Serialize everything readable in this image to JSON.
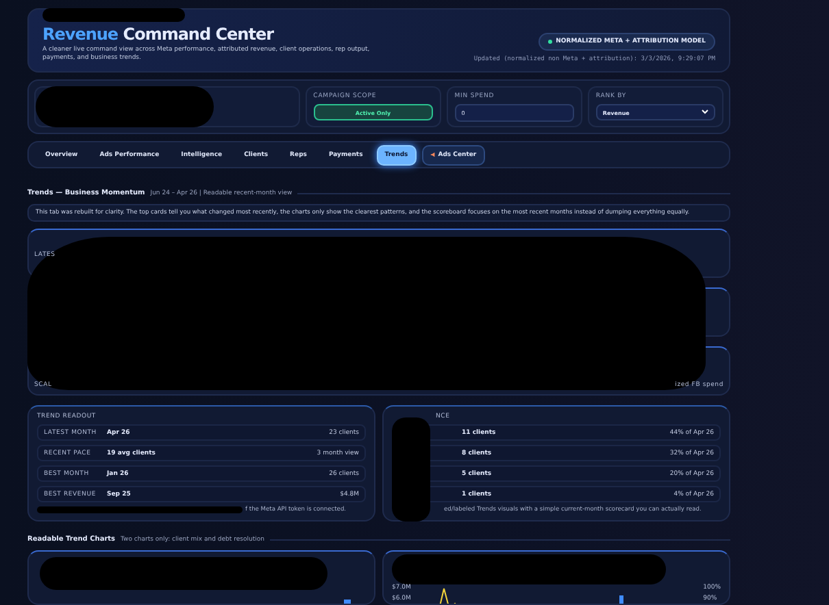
{
  "header": {
    "title_accent": "Revenue",
    "title": "Command Center",
    "subtitle": "A cleaner live command view across Meta performance, attributed revenue, client operations, rep output, payments, and business trends.",
    "badge": "NORMALIZED META + ATTRIBUTION MODEL",
    "updated": "Updated (normalized non Meta + attribution): 3/3/2026, 9:29:07 PM"
  },
  "filters": [
    {
      "kind": "toggle",
      "label": "CAMPAIGN SCOPE",
      "value": "Active Only"
    },
    {
      "kind": "input",
      "label": "MIN SPEND",
      "value": "0"
    },
    {
      "kind": "select",
      "label": "RANK BY",
      "value": "Revenue"
    }
  ],
  "tabs": [
    {
      "label": "Overview",
      "selected": false
    },
    {
      "label": "Ads Performance",
      "selected": false
    },
    {
      "label": "Intelligence",
      "selected": false
    },
    {
      "label": "Clients",
      "selected": false
    },
    {
      "label": "Reps",
      "selected": false
    },
    {
      "label": "Payments",
      "selected": false
    },
    {
      "label": "Trends",
      "selected": true
    },
    {
      "label": "Ads Center",
      "selected": false,
      "kind": "special"
    }
  ],
  "section": {
    "title": "Trends — Business Momentum",
    "subtitle": "Jun 24 – Apr 26 | Readable recent-month view",
    "note": "This tab was rebuilt for clarity. The top cards tell you what changed most recently, the charts only show the clearest patterns, and the scoreboard focuses on the most recent months instead of dumping everything equally."
  },
  "summary_cards": [
    {
      "kind": "summary",
      "label": "LATES"
    },
    {
      "kind": "summary"
    },
    {
      "kind": "summary",
      "footer_left": "SCAL",
      "footer": "ized FB spend"
    }
  ],
  "trend_readout": {
    "title": "TREND READOUT",
    "rows": [
      {
        "label": "LATEST MONTH",
        "value": "Apr 26",
        "note": "23 clients"
      },
      {
        "label": "RECENT PACE",
        "value": "19 avg clients",
        "note": "3 month view"
      },
      {
        "label": "BEST MONTH",
        "value": "Jan 26",
        "note": "26 clients"
      },
      {
        "label": "BEST REVENUE",
        "value": "Sep 25",
        "note": "$4.8M"
      }
    ],
    "footer": "f the Meta API token is connected."
  },
  "mix_card": {
    "title": "NCE",
    "rows": [
      {
        "value": "11 clients",
        "note": "44% of Apr 26"
      },
      {
        "value": "8 clients",
        "note": "32% of Apr 26"
      },
      {
        "value": "5 clients",
        "note": "20% of Apr 26"
      },
      {
        "value": "1 clients",
        "note": "4% of Apr 26"
      }
    ],
    "footer": "ed/labeled Trends visuals with a simple current-month scorecard you can actually read."
  },
  "charts_section": {
    "title": "Readable Trend Charts",
    "subtitle": "Two charts only: client mix and debt resolution"
  },
  "right_chart": {
    "left_axis": [
      "$7.0M",
      "$6.0M"
    ],
    "right_axis": [
      "100%",
      "90%"
    ]
  }
}
